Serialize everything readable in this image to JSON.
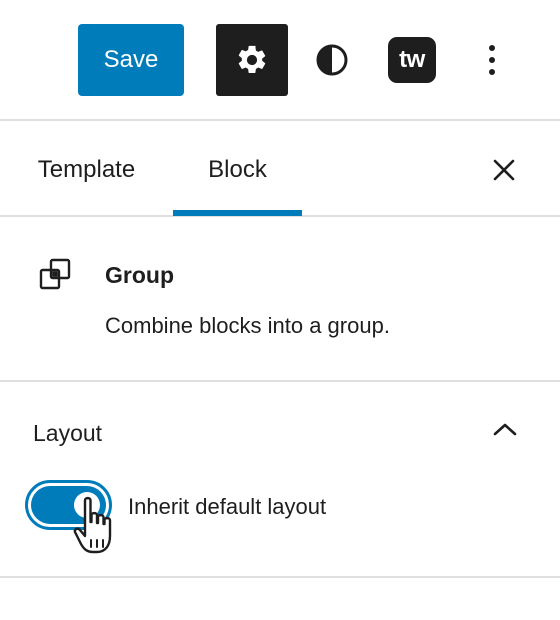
{
  "toolbar": {
    "save_label": "Save",
    "settings_icon": "gear-icon",
    "styles_icon": "half-circle-contrast-icon",
    "tw_label": "tw",
    "more_icon": "vertical-ellipsis-icon"
  },
  "tabs": [
    {
      "label": "Template",
      "selected": false
    },
    {
      "label": "Block",
      "selected": true
    }
  ],
  "close_icon": "close-icon",
  "block": {
    "icon": "group-icon",
    "title": "Group",
    "description": "Combine blocks into a group."
  },
  "layout": {
    "title": "Layout",
    "collapse_icon": "chevron-up-icon",
    "toggle_label": "Inherit default layout",
    "toggle_on": true
  },
  "colors": {
    "accent": "#007cba",
    "dark": "#1e1e1e",
    "divider": "#e0e0e0"
  }
}
